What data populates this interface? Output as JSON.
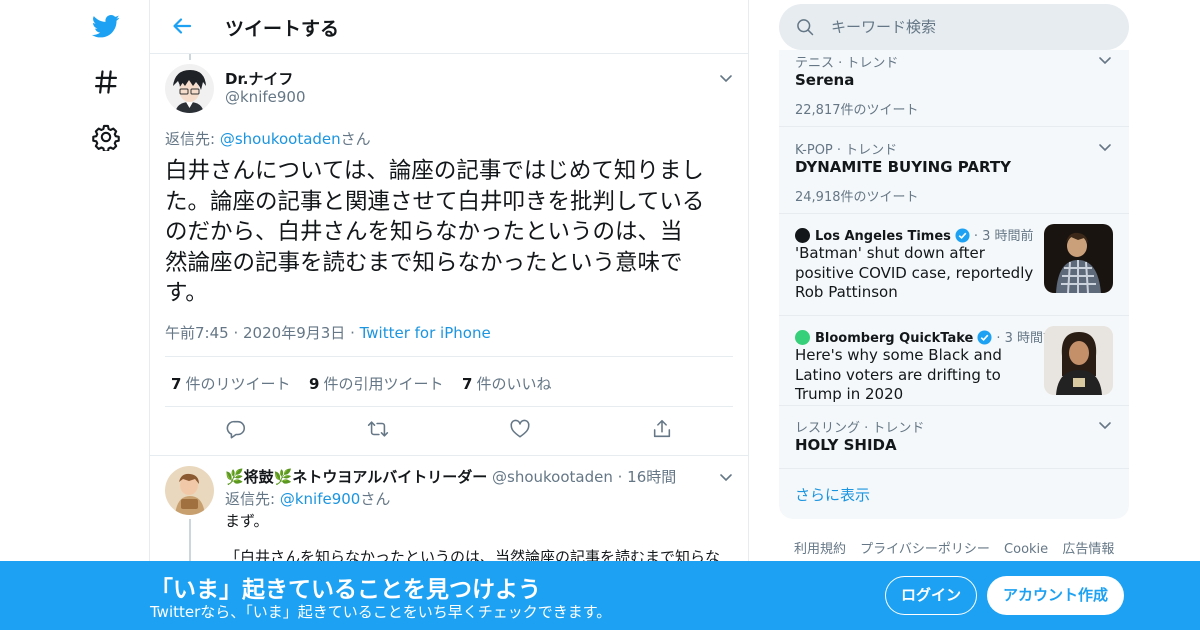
{
  "colors": {
    "accent": "#1da1f2",
    "link": "#1b95e0",
    "muted": "#657786",
    "border": "#e6ecf0"
  },
  "nav": {
    "icons": [
      "twitter-logo",
      "hashtag-icon",
      "settings-gear-icon"
    ]
  },
  "header": {
    "title": "ツイートする"
  },
  "tweet": {
    "author_name": "Dr.ナイフ",
    "author_handle": "@knife900",
    "reply_prefix": "返信先: ",
    "reply_to": "@shoukootaden",
    "reply_suffix": "さん",
    "text_lines": [
      "白井さんについては、論座の記事ではじめて知りまし",
      "た。論座の記事と関連させて白井叩きを批判している",
      "のだから、白井さんを知らなかったというのは、当",
      "然論座の記事を読むまで知らなかったという意味で",
      "す。"
    ],
    "time": "午前7:45",
    "date": "2020年9月3日",
    "source": "Twitter for iPhone",
    "retweets_count": "7",
    "retweets_label": "件のリツイート",
    "quotes_count": "9",
    "quotes_label": "件の引用ツイート",
    "likes_count": "7",
    "likes_label": "件のいいね"
  },
  "reply": {
    "name": "🌿将鼓🌿ネトウヨアルバイトリーダー",
    "handle": "@shoukootaden",
    "time": "16時間",
    "reply_prefix": "返信先: ",
    "reply_to": "@knife900",
    "reply_suffix": "さん",
    "line1": "まず。",
    "line2": "「白井さんを知らなかったというのは、当然論座の記事を読むまで知らな"
  },
  "search": {
    "placeholder": "キーワード検索"
  },
  "trends": [
    {
      "category": "テニス · トレンド",
      "name": "Serena",
      "count": "22,817件のツイート"
    },
    {
      "category": "K-POP · トレンド",
      "name": "DYNAMITE BUYING PARTY",
      "count": "24,918件のツイート"
    }
  ],
  "news": [
    {
      "source": "Los Angeles Times",
      "time": "3 時間前",
      "title": "'Batman' shut down after positive COVID case, reportedly Rob Pattinson"
    },
    {
      "source": "Bloomberg QuickTake",
      "time": "3 時間前",
      "title": "Here's why some Black and Latino voters are drifting to Trump in 2020"
    }
  ],
  "trend_last": {
    "category": "レスリング · トレンド",
    "name": "HOLY SHIDA"
  },
  "show_more": "さらに表示",
  "footer_links": [
    "利用規約",
    "プライバシーポリシー",
    "Cookie",
    "広告情報"
  ],
  "banner": {
    "title": "「いま」起きていることを見つけよう",
    "subtitle": "Twitterなら、「いま」起きていることをいち早くチェックできます。",
    "login": "ログイン",
    "signup": "アカウント作成"
  }
}
